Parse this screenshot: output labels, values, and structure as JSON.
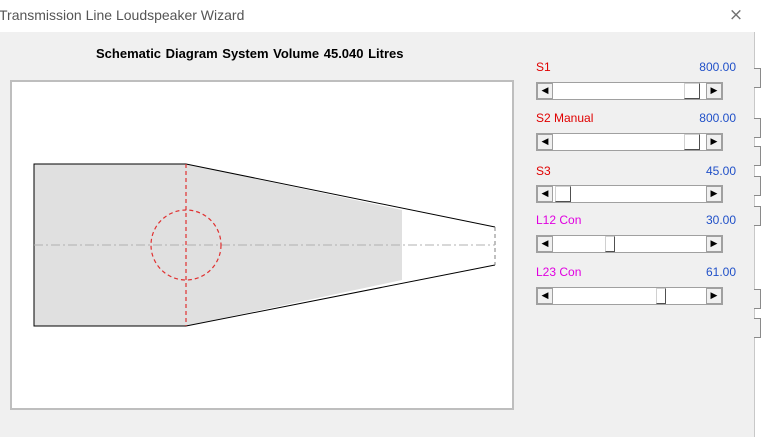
{
  "window": {
    "title": "Transmission Line Loudspeaker Wizard",
    "close_glyph": "×"
  },
  "diagram": {
    "heading": "Schematic Diagram   System Volume 45.040 Litres",
    "fill_color": "#e0e0e0",
    "driver_color": "#e03030"
  },
  "sliders": [
    {
      "label": "S1",
      "value": "800.00",
      "label_color": "#e00000",
      "level": 0.84
    },
    {
      "label": "S2  Manual",
      "value": "800.00",
      "label_color": "#e00000",
      "level": 0.84
    },
    {
      "label": "S3",
      "value": "45.00",
      "label_color": "#e00000",
      "level": 0.05
    },
    {
      "label": "L12  Con",
      "value": "30.00",
      "label_color": "#e000e0",
      "level": 0.3
    },
    {
      "label": "L23  Con",
      "value": "61.00",
      "label_color": "#e000e0",
      "level": 0.61
    }
  ],
  "icons": {
    "left_arrow": "◀",
    "right_arrow": "▶"
  }
}
